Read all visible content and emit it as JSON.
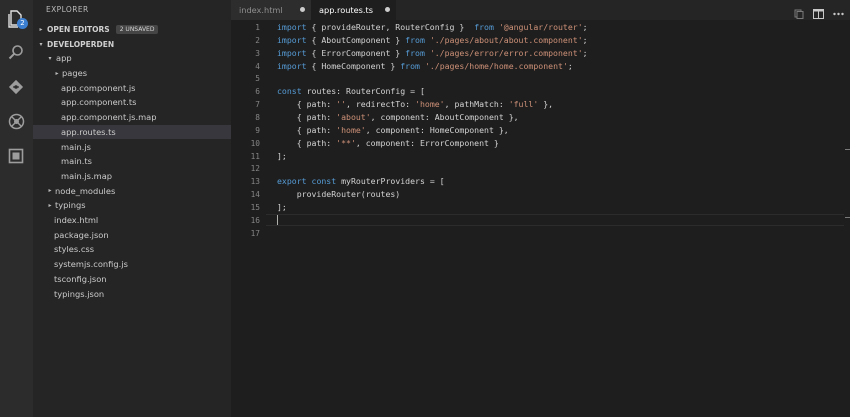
{
  "activity": {
    "badge": "2",
    "icons": [
      "files-icon",
      "search-icon",
      "git-icon",
      "debug-icon",
      "extensions-icon"
    ]
  },
  "sidebar": {
    "title": "EXPLORER",
    "open_editors": {
      "label": "OPEN EDITORS",
      "badge": "2 UNSAVED"
    },
    "project": {
      "label": "DEVELOPERDEN"
    },
    "tree": [
      {
        "label": "app",
        "twisty": "▾"
      },
      {
        "label": "pages",
        "twisty": "▸"
      },
      {
        "label": "app.component.js",
        "twisty": ""
      },
      {
        "label": "app.component.ts",
        "twisty": ""
      },
      {
        "label": "app.component.js.map",
        "twisty": ""
      },
      {
        "label": "app.routes.ts",
        "twisty": ""
      },
      {
        "label": "main.js",
        "twisty": ""
      },
      {
        "label": "main.ts",
        "twisty": ""
      },
      {
        "label": "main.js.map",
        "twisty": ""
      },
      {
        "label": "node_modules",
        "twisty": "▸"
      },
      {
        "label": "typings",
        "twisty": "▸"
      },
      {
        "label": "index.html",
        "twisty": ""
      },
      {
        "label": "package.json",
        "twisty": ""
      },
      {
        "label": "styles.css",
        "twisty": ""
      },
      {
        "label": "systemjs.config.js",
        "twisty": ""
      },
      {
        "label": "tsconfig.json",
        "twisty": ""
      },
      {
        "label": "typings.json",
        "twisty": ""
      }
    ]
  },
  "tabs": [
    {
      "label": "index.html"
    },
    {
      "label": "app.routes.ts"
    }
  ],
  "editor": {
    "line_numbers": [
      "1",
      "2",
      "3",
      "4",
      "5",
      "6",
      "7",
      "8",
      "9",
      "10",
      "11",
      "12",
      "13",
      "14",
      "15",
      "16",
      "17"
    ],
    "lines": [
      [
        {
          "t": "import",
          "c": "k"
        },
        {
          "t": " { provideRouter, RouterConfig }  ",
          "c": ""
        },
        {
          "t": "from",
          "c": "k"
        },
        {
          "t": " ",
          "c": ""
        },
        {
          "t": "'@angular/router'",
          "c": "s"
        },
        {
          "t": ";",
          "c": ""
        }
      ],
      [
        {
          "t": "import",
          "c": "k"
        },
        {
          "t": " { AboutComponent } ",
          "c": ""
        },
        {
          "t": "from",
          "c": "k"
        },
        {
          "t": " ",
          "c": ""
        },
        {
          "t": "'./pages/about/about.component'",
          "c": "s"
        },
        {
          "t": ";",
          "c": ""
        }
      ],
      [
        {
          "t": "import",
          "c": "k"
        },
        {
          "t": " { ErrorComponent } ",
          "c": ""
        },
        {
          "t": "from",
          "c": "k"
        },
        {
          "t": " ",
          "c": ""
        },
        {
          "t": "'./pages/error/error.component'",
          "c": "s"
        },
        {
          "t": ";",
          "c": ""
        }
      ],
      [
        {
          "t": "import",
          "c": "k"
        },
        {
          "t": " { HomeComponent } ",
          "c": ""
        },
        {
          "t": "from",
          "c": "k"
        },
        {
          "t": " ",
          "c": ""
        },
        {
          "t": "'./pages/home/home.component'",
          "c": "s"
        },
        {
          "t": ";",
          "c": ""
        }
      ],
      [],
      [
        {
          "t": "const",
          "c": "k"
        },
        {
          "t": " routes: RouterConfig = [",
          "c": ""
        }
      ],
      [
        {
          "t": "    { path: ",
          "c": ""
        },
        {
          "t": "''",
          "c": "s"
        },
        {
          "t": ", redirectTo: ",
          "c": ""
        },
        {
          "t": "'home'",
          "c": "s"
        },
        {
          "t": ", pathMatch: ",
          "c": ""
        },
        {
          "t": "'full'",
          "c": "s"
        },
        {
          "t": " },",
          "c": ""
        }
      ],
      [
        {
          "t": "    { path: ",
          "c": ""
        },
        {
          "t": "'about'",
          "c": "s"
        },
        {
          "t": ", component: AboutComponent },",
          "c": ""
        }
      ],
      [
        {
          "t": "    { path: ",
          "c": ""
        },
        {
          "t": "'home'",
          "c": "s"
        },
        {
          "t": ", component: HomeComponent },",
          "c": ""
        }
      ],
      [
        {
          "t": "    { path: ",
          "c": ""
        },
        {
          "t": "'**'",
          "c": "s"
        },
        {
          "t": ", component: ErrorComponent }",
          "c": ""
        }
      ],
      [
        {
          "t": "];",
          "c": ""
        }
      ],
      [],
      [
        {
          "t": "export",
          "c": "k"
        },
        {
          "t": " ",
          "c": ""
        },
        {
          "t": "const",
          "c": "k"
        },
        {
          "t": " myRouterProviders = [",
          "c": ""
        }
      ],
      [
        {
          "t": "    provideRouter(routes)",
          "c": ""
        }
      ],
      [
        {
          "t": "];",
          "c": ""
        }
      ],
      [],
      []
    ]
  }
}
